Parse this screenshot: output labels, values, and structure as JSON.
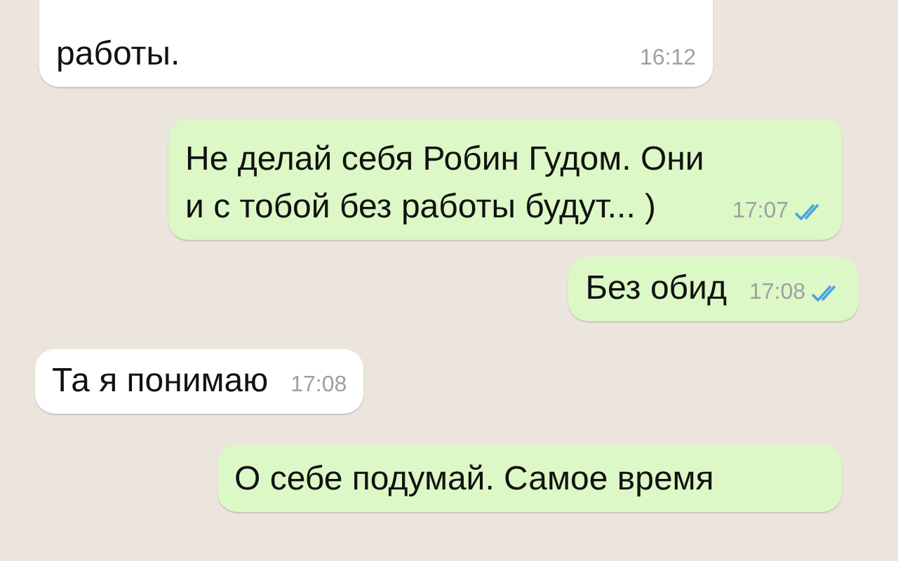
{
  "messages": [
    {
      "kind": "incoming",
      "text": "работы.",
      "time": "16:12"
    },
    {
      "kind": "outgoing",
      "text": "Не делай себя Робин Гудом. Они\nи с тобой без работы будут... )",
      "time": "17:07",
      "read": true
    },
    {
      "kind": "outgoing",
      "text": "Без обид",
      "time": "17:08",
      "read": true
    },
    {
      "kind": "incoming",
      "text": "Та я понимаю",
      "time": "17:08"
    },
    {
      "kind": "outgoing",
      "text": "О себе подумай. Самое время"
    }
  ]
}
